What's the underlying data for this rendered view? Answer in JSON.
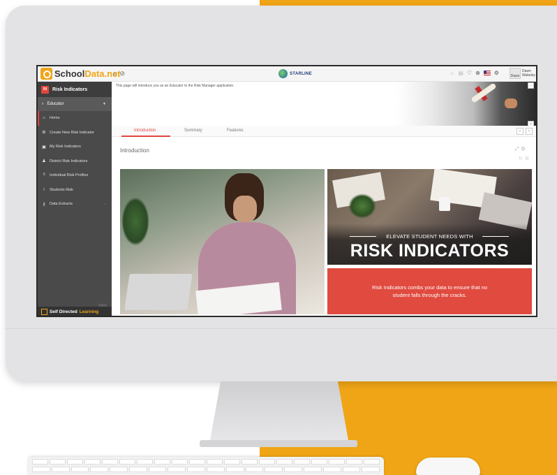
{
  "app": {
    "logo_text_a": "School",
    "logo_text_b": "Data.net",
    "district_name": "STARLINE",
    "user_name": "Dawn Wakeley",
    "avatar_alt": "Dawn"
  },
  "topbar": {
    "left_icons": [
      "⌂",
      "⊘"
    ],
    "right_icons": [
      "☼",
      "▤",
      "♡",
      "⊗",
      "⚙"
    ]
  },
  "sidebar": {
    "badge": "RI",
    "title": "Risk Indicators",
    "role": "Educator",
    "items": [
      {
        "label": "Home",
        "icon": "home-icon",
        "glyph": "⌂"
      },
      {
        "label": "Create New Risk Indicator",
        "icon": "settings-icon",
        "glyph": "⚙"
      },
      {
        "label": "My Risk Indicators",
        "icon": "id-card-icon",
        "glyph": "▣"
      },
      {
        "label": "District Risk Indicators",
        "icon": "people-icon",
        "glyph": "♟"
      },
      {
        "label": "Individual Risk Profiles",
        "icon": "help-circle-icon",
        "glyph": "?"
      },
      {
        "label": "Students Risk",
        "icon": "person-icon",
        "glyph": "i"
      },
      {
        "label": "Data Extracts",
        "icon": "key-icon",
        "glyph": "⚷"
      }
    ],
    "collapse_glyph": "‹",
    "footer_a": "Self Directed",
    "footer_b": "Learning"
  },
  "content": {
    "intro_text": "This page will introduce you as an Educator to the Risk Manager application.",
    "tabs": [
      "Introduction",
      "Summary",
      "Features"
    ],
    "active_tab": "Introduction",
    "section_title": "Introduction",
    "promo_subtitle": "ELEVATE STUDENT NEEDS WITH",
    "promo_title": "RISK INDICATORS",
    "promo_tagline": "Risk Indicators combs your data to ensure that no student falls through the cracks."
  },
  "colors": {
    "brand_orange": "#f0a516",
    "accent_red": "#e0473e",
    "sidebar_bg": "#4a4a4a"
  }
}
